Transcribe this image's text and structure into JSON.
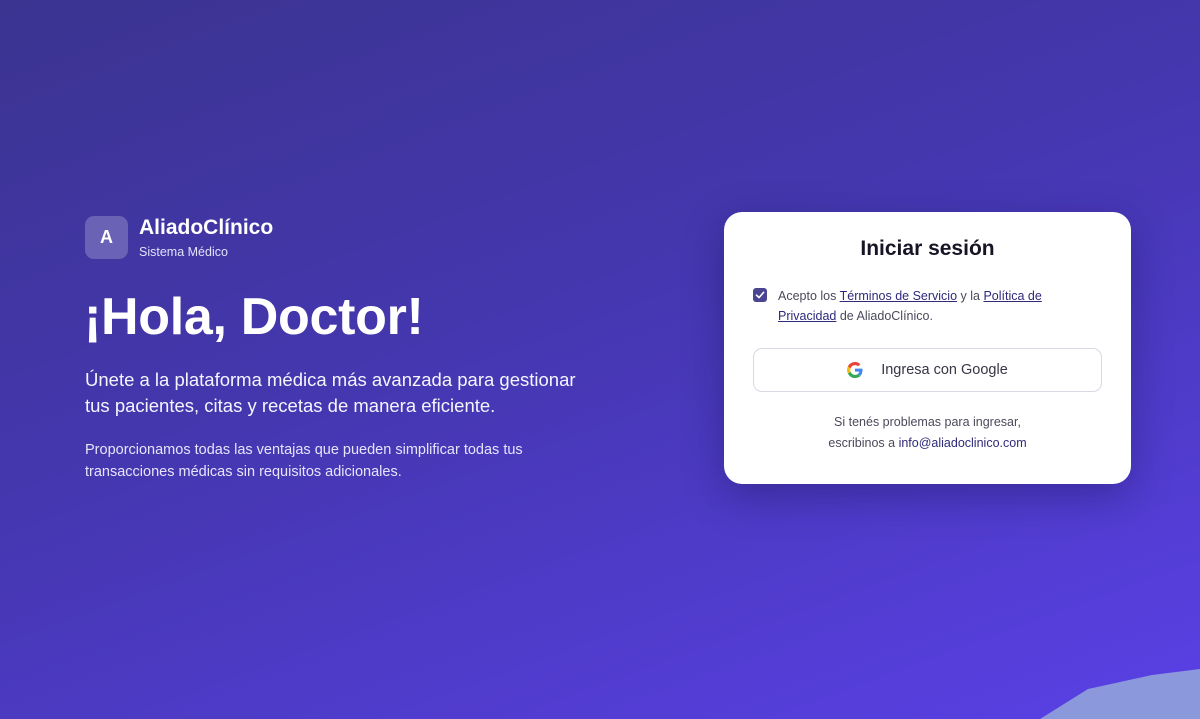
{
  "brand": {
    "logo_letter": "A",
    "name": "AliadoClínico",
    "subtitle": "Sistema Médico"
  },
  "hero": {
    "title": "¡Hola, Doctor!",
    "lead": "Únete a la plataforma médica más avanzada para gestionar tus pacientes, citas y recetas de manera eficiente.",
    "body": "Proporcionamos todas las ventajas que pueden simplificar todas tus transacciones médicas sin requisitos adicionales."
  },
  "login": {
    "title": "Iniciar sesión",
    "terms": {
      "checked": true,
      "prefix": "Acepto los ",
      "terms_link": "Términos de Servicio",
      "middle": " y la ",
      "privacy_link": "Política de Privacidad",
      "suffix": " de AliadoClínico."
    },
    "google_button": {
      "icon": "google-icon",
      "label": "Ingresa con Google"
    },
    "help": {
      "line1": "Si tenés problemas para ingresar,",
      "line2_prefix": "escribinos a ",
      "email": "info@aliadoclinico.com"
    }
  },
  "colors": {
    "background_start": "#3b3490",
    "background_end": "#5a40e6",
    "checkbox": "#4b4591",
    "link": "#2f2a7a"
  }
}
